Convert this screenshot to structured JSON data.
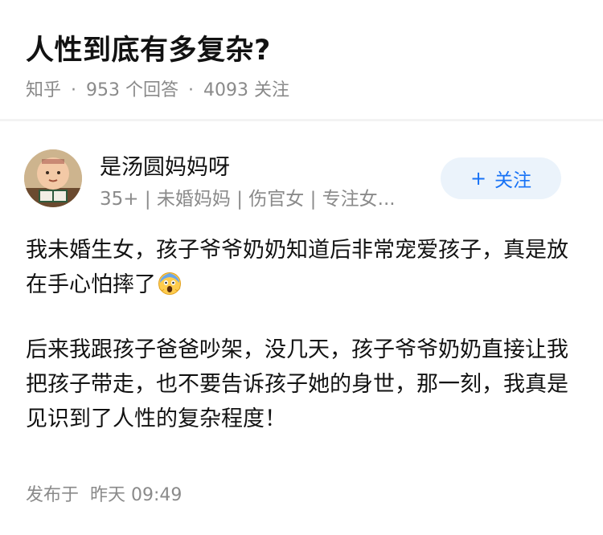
{
  "question": {
    "title": "人性到底有多复杂?",
    "source": "知乎",
    "answers": "953 个回答",
    "followers": "4093 关注"
  },
  "author": {
    "name": "是汤圆妈妈呀",
    "bio": "35+ | 未婚妈妈 | 伤官女 | 专注女...",
    "follow_label": "关注",
    "follow_icon": "plus-icon"
  },
  "answer": {
    "paragraph1": "我未婚生女，孩子爷爷奶奶知道后非常宠爱孩子，真是放在手心怕摔了",
    "emoji": "face-screaming-icon",
    "paragraph2": "后来我跟孩子爸爸吵架，没几天，孩子爷爷奶奶直接让我把孩子带走，也不要告诉孩子她的身世，那一刻，我真是见识到了人性的复杂程度！"
  },
  "footer": {
    "label": "发布于",
    "time": "昨天 09:49"
  },
  "colors": {
    "accent": "#1772f6",
    "follow_bg": "#ebf3fb",
    "meta_text": "#8a8a8a"
  }
}
